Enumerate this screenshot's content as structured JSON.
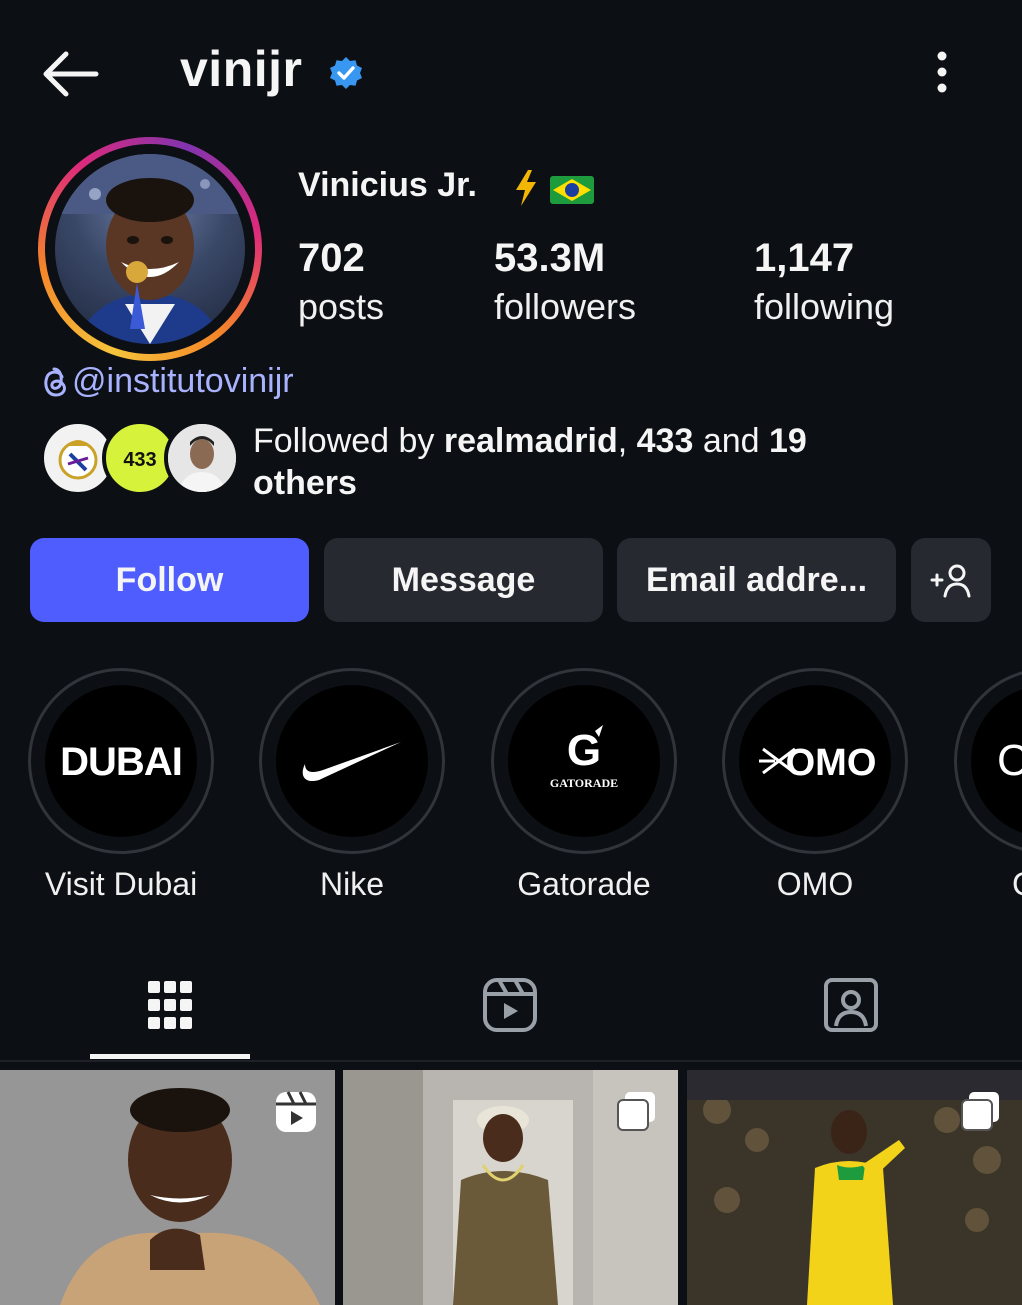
{
  "header": {
    "username": "vinijr",
    "back_icon": "arrow-left-icon",
    "verified_icon": "verified-badge-icon",
    "more_icon": "more-vertical-icon"
  },
  "profile": {
    "full_name": "Vinicius Jr.",
    "name_emoji": [
      "lightning-icon",
      "brazil-flag-icon"
    ],
    "stats": [
      {
        "value": "702",
        "label": "posts"
      },
      {
        "value": "53.3M",
        "label": "followers"
      },
      {
        "value": "1,147",
        "label": "following"
      }
    ],
    "threads_handle": "@institutovinijr",
    "followed_by": {
      "prefix": "Followed by ",
      "account1": "realmadrid",
      "sep": ", ",
      "account2": "433",
      "and": " and ",
      "count": "19",
      "others": "others"
    }
  },
  "actions": {
    "follow": "Follow",
    "message": "Message",
    "email": "Email addre...",
    "add_person_icon": "add-person-icon"
  },
  "highlights": [
    {
      "label": "Visit Dubai",
      "logo": "DUBAI"
    },
    {
      "label": "Nike",
      "logo": "nike-swoosh"
    },
    {
      "label": "Gatorade",
      "logo": "GATORADE"
    },
    {
      "label": "OMO",
      "logo": "OMO"
    },
    {
      "label": "C",
      "logo": "C"
    }
  ],
  "tabs": [
    "grid-icon",
    "reels-icon",
    "tagged-icon"
  ],
  "colors": {
    "background": "#0c1014",
    "follow_button": "#4f5dff",
    "secondary_button": "#262a30",
    "verified": "#3897f0",
    "threads_link": "#a8b2ff"
  }
}
